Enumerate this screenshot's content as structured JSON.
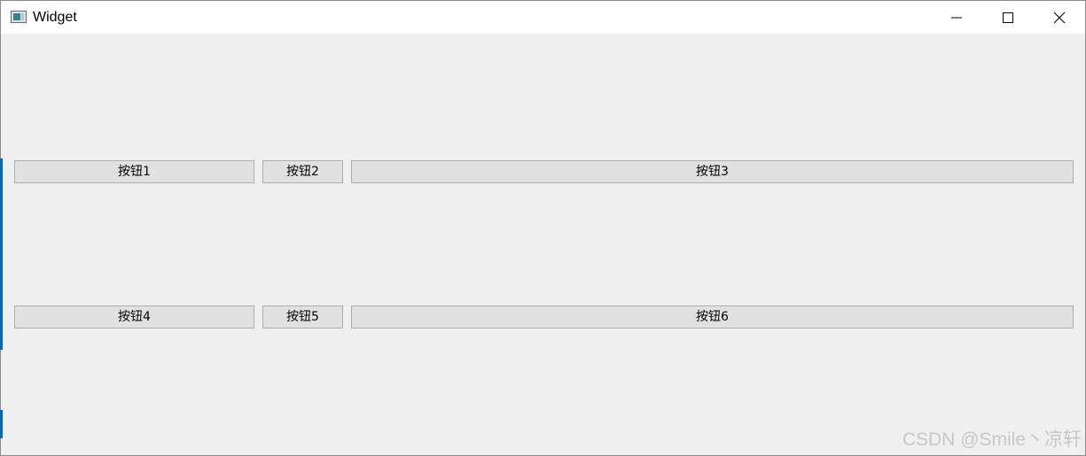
{
  "window": {
    "title": "Widget",
    "app_icon": "qt-widget-app-icon",
    "controls": {
      "minimize_icon": "minimize-icon",
      "maximize_icon": "maximize-icon",
      "close_icon": "close-icon"
    }
  },
  "buttons": {
    "row1": [
      {
        "label": "按钮1"
      },
      {
        "label": "按钮2"
      },
      {
        "label": "按钮3"
      }
    ],
    "row2": [
      {
        "label": "按钮4"
      },
      {
        "label": "按钮5"
      },
      {
        "label": "按钮6"
      }
    ]
  },
  "watermark": "CSDN @Smile丶凉轩",
  "colors": {
    "window_background": "#f0f0f0",
    "titlebar_background": "#ffffff",
    "button_background": "#e1e1e1",
    "button_border": "#adadad",
    "accent": "#0a64b8"
  }
}
